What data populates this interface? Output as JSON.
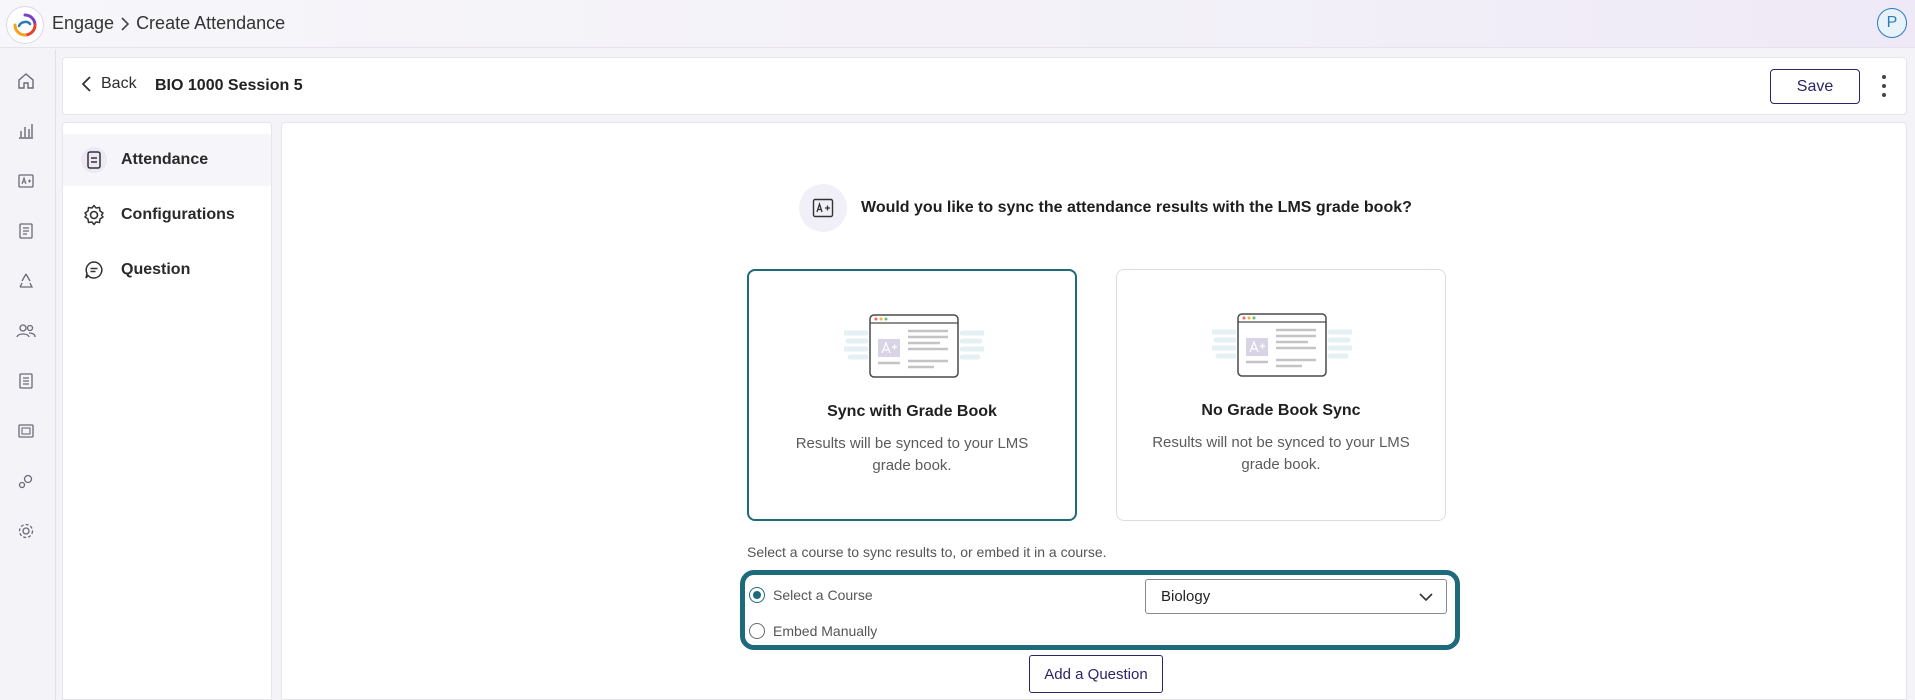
{
  "breadcrumb": {
    "app": "Engage",
    "page": "Create Attendance"
  },
  "user": {
    "avatar_initial": "P"
  },
  "header": {
    "back_label": "Back",
    "session_title": "BIO 1000 Session 5",
    "save_label": "Save"
  },
  "rail": {
    "items": [
      "home-icon",
      "bar-chart-icon",
      "grade-icon",
      "report-icon",
      "recycle-icon",
      "users-icon",
      "list-icon",
      "gallery-icon",
      "integrations-icon",
      "settings-icon"
    ]
  },
  "sidenav": {
    "items": [
      {
        "label": "Attendance",
        "icon": "document-icon",
        "active": true
      },
      {
        "label": "Configurations",
        "icon": "gear-icon",
        "active": false
      },
      {
        "label": "Question",
        "icon": "chat-icon",
        "active": false
      }
    ]
  },
  "main": {
    "question": "Would you like to sync the attendance results with the LMS grade book?",
    "options": [
      {
        "title": "Sync with Grade Book",
        "desc": "Results will be synced to your LMS grade book.",
        "selected": true
      },
      {
        "title": "No Grade Book Sync",
        "desc": "Results will not be synced to your LMS grade book.",
        "selected": false
      }
    ],
    "hint": "Select a course to sync results to, or embed it in a course.",
    "radio_select_course": "Select a Course",
    "radio_embed": "Embed Manually",
    "course_value": "Biology",
    "add_question_label": "Add a Question"
  },
  "colors": {
    "accent_teal": "#1d6b7a",
    "brand_purple": "#2e2366",
    "avatar_blue": "#2b7bb9"
  }
}
